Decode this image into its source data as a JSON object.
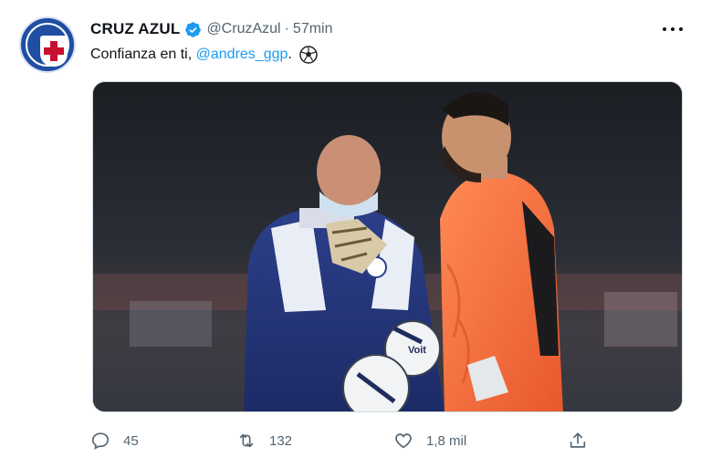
{
  "tweet": {
    "author_name": "CRUZ AZUL",
    "handle": "@CruzAzul",
    "separator": "·",
    "time": "57min",
    "text_prefix": "Confianza en ti, ",
    "mention": "@andres_ggp",
    "text_suffix": ".",
    "emoji": "soccer-ball-icon",
    "media_description": "Photo of goalkeeper coach in blue tracksuit and face mask talking with goalkeeper in orange jersey holding soccer balls in stadium",
    "ball_brand": "Voit"
  },
  "actions": {
    "replies": "45",
    "retweets": "132",
    "likes": "1,8 mil"
  },
  "colors": {
    "link": "#1d9bf0",
    "secondary_text": "#536471",
    "verified": "#1d9bf0",
    "brand_blue": "#1f4ea3"
  }
}
